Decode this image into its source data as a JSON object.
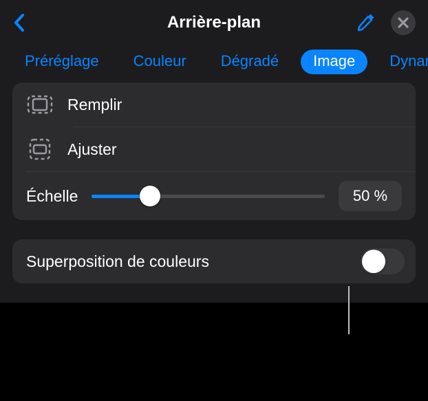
{
  "header": {
    "title": "Arrière-plan"
  },
  "tabs": {
    "items": [
      {
        "label": "Préréglage",
        "active": false
      },
      {
        "label": "Couleur",
        "active": false
      },
      {
        "label": "Dégradé",
        "active": false
      },
      {
        "label": "Image",
        "active": true
      },
      {
        "label": "Dynamique",
        "active": false
      }
    ]
  },
  "scaleModes": {
    "fill": {
      "label": "Remplir"
    },
    "fit": {
      "label": "Ajuster"
    }
  },
  "scale": {
    "label": "Échelle",
    "value_text": "50 %",
    "percent": 25
  },
  "overlay": {
    "label": "Superposition de couleurs",
    "enabled": false
  }
}
